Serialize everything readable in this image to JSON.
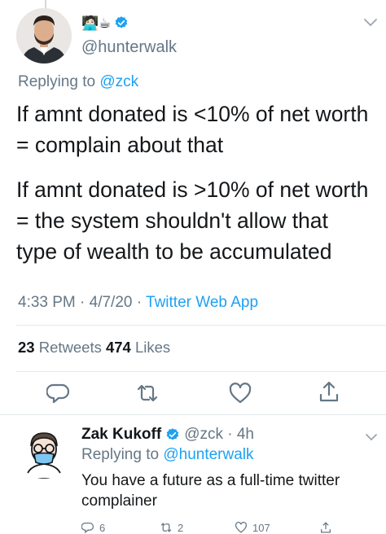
{
  "tweet": {
    "emojis": "🧑🏻‍💻☕",
    "handle": "@hunterwalk",
    "replying_prefix": "Replying to ",
    "replying_to": "@zck",
    "paragraph_1": "If amnt donated is <10% of net worth\n= complain about that",
    "paragraph_2": "If amnt donated is >10% of net worth\n= the system shouldn't allow that\ntype of wealth to be accumulated",
    "time": "4:33 PM · 4/7/20 · ",
    "source": "Twitter Web App",
    "retweets_count": "23",
    "retweets_label": " Retweets ",
    "likes_count": "474",
    "likes_label": " Likes"
  },
  "actions": [
    "reply-icon",
    "retweet-icon",
    "like-icon",
    "share-icon"
  ],
  "reply": {
    "name": "Zak Kukoff",
    "handle_time": "@zck · 4h",
    "replying_prefix": "Replying to ",
    "replying_to": "@hunterwalk",
    "text": "You have a future as a full-time twitter complainer",
    "reply_count": "6",
    "retweet_count": "2",
    "like_count": "107"
  },
  "colors": {
    "accent": "#1da1f2",
    "muted": "#657786",
    "text": "#14171a",
    "divider": "#e1e8ed"
  }
}
